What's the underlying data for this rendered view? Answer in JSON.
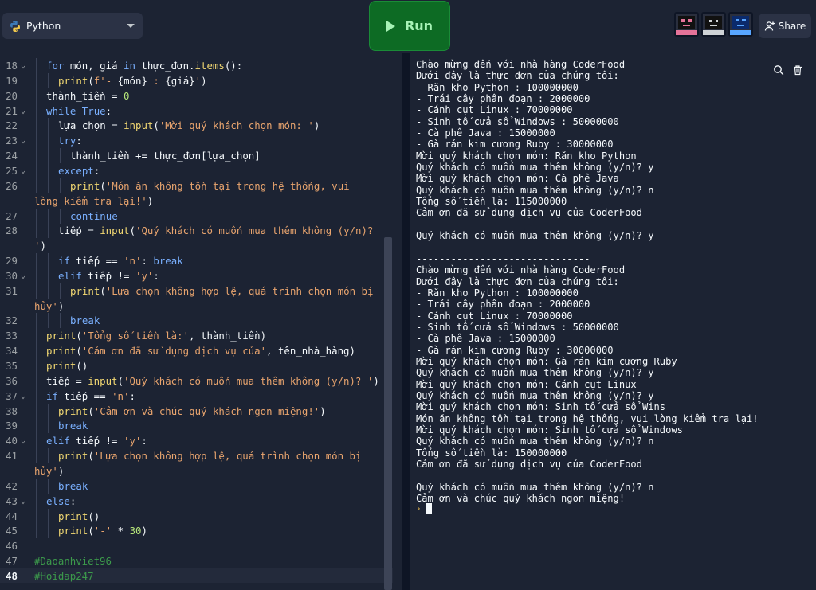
{
  "topbar": {
    "language": "Python",
    "run_label": "Run",
    "share_label": "Share"
  },
  "icons": {
    "python": "python-logo-icon",
    "dropdown": "chevron-down-icon",
    "run": "play-icon",
    "share": "add-user-icon",
    "search": "search-icon",
    "clear": "trash-icon"
  },
  "colors": {
    "accent_run": "#0d6b24",
    "run_text": "#a7f3b6",
    "keyword": "#7ab0ff",
    "function": "#f2d872",
    "string": "#e8a46e",
    "number": "#b6e67a",
    "comment": "#3c9a4b",
    "background": "#1c2333"
  },
  "editor": {
    "lines": [
      {
        "num": "18",
        "fold": true,
        "indent": 1,
        "parts": [
          [
            "k",
            "for"
          ],
          [
            "t",
            " món, giá "
          ],
          [
            "k",
            "in"
          ],
          [
            "t",
            " thực_đơn."
          ],
          [
            "f",
            "items"
          ],
          [
            "t",
            "():"
          ]
        ]
      },
      {
        "num": "19",
        "fold": false,
        "indent": 2,
        "parts": [
          [
            "f",
            "print"
          ],
          [
            "t",
            "("
          ],
          [
            "s",
            "f'- "
          ],
          [
            "t",
            "{món}"
          ],
          [
            "s",
            " : "
          ],
          [
            "t",
            "{giá}"
          ],
          [
            "s",
            "'"
          ],
          [
            "t",
            ")"
          ]
        ]
      },
      {
        "num": "20",
        "fold": false,
        "indent": 1,
        "parts": [
          [
            "t",
            "thành_tiền = "
          ],
          [
            "n",
            "0"
          ]
        ]
      },
      {
        "num": "21",
        "fold": true,
        "indent": 1,
        "parts": [
          [
            "k",
            "while"
          ],
          [
            "t",
            " "
          ],
          [
            "k",
            "True"
          ],
          [
            "t",
            ":"
          ]
        ]
      },
      {
        "num": "22",
        "fold": false,
        "indent": 2,
        "parts": [
          [
            "t",
            "lựa_chọn = "
          ],
          [
            "f",
            "input"
          ],
          [
            "t",
            "("
          ],
          [
            "s",
            "'Mời quý khách chọn món: '"
          ],
          [
            "t",
            ")"
          ]
        ]
      },
      {
        "num": "23",
        "fold": true,
        "indent": 2,
        "parts": [
          [
            "k",
            "try"
          ],
          [
            "t",
            ":"
          ]
        ]
      },
      {
        "num": "24",
        "fold": false,
        "indent": 3,
        "parts": [
          [
            "t",
            "thành_tiền += thực_đơn[lựa_chọn]"
          ]
        ]
      },
      {
        "num": "25",
        "fold": true,
        "indent": 2,
        "parts": [
          [
            "k",
            "except"
          ],
          [
            "t",
            ":"
          ]
        ]
      },
      {
        "num": "26",
        "fold": false,
        "indent": 3,
        "parts": [
          [
            "f",
            "print"
          ],
          [
            "t",
            "("
          ],
          [
            "s",
            "'Món ăn không tồn tại trong hệ thống, vui"
          ]
        ]
      },
      {
        "num": "",
        "fold": false,
        "indent": 0,
        "parts": [
          [
            "s",
            "lòng kiểm tra lại!'"
          ],
          [
            "t",
            ")"
          ]
        ]
      },
      {
        "num": "27",
        "fold": false,
        "indent": 3,
        "parts": [
          [
            "k",
            "continue"
          ]
        ]
      },
      {
        "num": "28",
        "fold": false,
        "indent": 2,
        "parts": [
          [
            "t",
            "tiếp = "
          ],
          [
            "f",
            "input"
          ],
          [
            "t",
            "("
          ],
          [
            "s",
            "'Quý khách có muốn mua thêm không (y/n)?"
          ]
        ]
      },
      {
        "num": "",
        "fold": false,
        "indent": 0,
        "parts": [
          [
            "s",
            "'"
          ],
          [
            "t",
            ")"
          ]
        ]
      },
      {
        "num": "29",
        "fold": false,
        "indent": 2,
        "parts": [
          [
            "k",
            "if"
          ],
          [
            "t",
            " tiếp == "
          ],
          [
            "s",
            "'n'"
          ],
          [
            "t",
            ": "
          ],
          [
            "k",
            "break"
          ]
        ]
      },
      {
        "num": "30",
        "fold": true,
        "indent": 2,
        "parts": [
          [
            "k",
            "elif"
          ],
          [
            "t",
            " tiếp != "
          ],
          [
            "s",
            "'y'"
          ],
          [
            "t",
            ":"
          ]
        ]
      },
      {
        "num": "31",
        "fold": false,
        "indent": 3,
        "parts": [
          [
            "f",
            "print"
          ],
          [
            "t",
            "("
          ],
          [
            "s",
            "'Lựa chọn không hợp lệ, quá trình chọn món bị"
          ]
        ]
      },
      {
        "num": "",
        "fold": false,
        "indent": 0,
        "parts": [
          [
            "s",
            "hủy'"
          ],
          [
            "t",
            ")"
          ]
        ]
      },
      {
        "num": "32",
        "fold": false,
        "indent": 3,
        "parts": [
          [
            "k",
            "break"
          ]
        ]
      },
      {
        "num": "33",
        "fold": false,
        "indent": 1,
        "parts": [
          [
            "f",
            "print"
          ],
          [
            "t",
            "("
          ],
          [
            "s",
            "'Tổng số tiền là:'"
          ],
          [
            "t",
            ", thành_tiền)"
          ]
        ]
      },
      {
        "num": "34",
        "fold": false,
        "indent": 1,
        "parts": [
          [
            "f",
            "print"
          ],
          [
            "t",
            "("
          ],
          [
            "s",
            "'Cảm ơn đã sử dụng dịch vụ của'"
          ],
          [
            "t",
            ", tên_nhà_hàng)"
          ]
        ]
      },
      {
        "num": "35",
        "fold": false,
        "indent": 1,
        "parts": [
          [
            "f",
            "print"
          ],
          [
            "t",
            "()"
          ]
        ]
      },
      {
        "num": "36",
        "fold": false,
        "indent": 1,
        "parts": [
          [
            "t",
            "tiếp = "
          ],
          [
            "f",
            "input"
          ],
          [
            "t",
            "("
          ],
          [
            "s",
            "'Quý khách có muốn mua thêm không (y/n)? '"
          ],
          [
            "t",
            ")"
          ]
        ]
      },
      {
        "num": "37",
        "fold": true,
        "indent": 1,
        "parts": [
          [
            "k",
            "if"
          ],
          [
            "t",
            " tiếp == "
          ],
          [
            "s",
            "'n'"
          ],
          [
            "t",
            ":"
          ]
        ]
      },
      {
        "num": "38",
        "fold": false,
        "indent": 2,
        "parts": [
          [
            "f",
            "print"
          ],
          [
            "t",
            "("
          ],
          [
            "s",
            "'Cảm ơn và chúc quý khách ngon miệng!'"
          ],
          [
            "t",
            ")"
          ]
        ]
      },
      {
        "num": "39",
        "fold": false,
        "indent": 2,
        "parts": [
          [
            "k",
            "break"
          ]
        ]
      },
      {
        "num": "40",
        "fold": true,
        "indent": 1,
        "parts": [
          [
            "k",
            "elif"
          ],
          [
            "t",
            " tiếp != "
          ],
          [
            "s",
            "'y'"
          ],
          [
            "t",
            ":"
          ]
        ]
      },
      {
        "num": "41",
        "fold": false,
        "indent": 2,
        "parts": [
          [
            "f",
            "print"
          ],
          [
            "t",
            "("
          ],
          [
            "s",
            "'Lựa chọn không hợp lệ, quá trình chọn món bị"
          ]
        ]
      },
      {
        "num": "",
        "fold": false,
        "indent": 0,
        "parts": [
          [
            "s",
            "hủy'"
          ],
          [
            "t",
            ")"
          ]
        ]
      },
      {
        "num": "42",
        "fold": false,
        "indent": 2,
        "parts": [
          [
            "k",
            "break"
          ]
        ]
      },
      {
        "num": "43",
        "fold": true,
        "indent": 1,
        "parts": [
          [
            "k",
            "else"
          ],
          [
            "t",
            ":"
          ]
        ]
      },
      {
        "num": "44",
        "fold": false,
        "indent": 2,
        "parts": [
          [
            "f",
            "print"
          ],
          [
            "t",
            "()"
          ]
        ]
      },
      {
        "num": "45",
        "fold": false,
        "indent": 2,
        "parts": [
          [
            "f",
            "print"
          ],
          [
            "t",
            "("
          ],
          [
            "s",
            "'-'"
          ],
          [
            "t",
            " * "
          ],
          [
            "n",
            "30"
          ],
          [
            "t",
            ")"
          ]
        ]
      },
      {
        "num": "46",
        "fold": false,
        "indent": 0,
        "parts": []
      },
      {
        "num": "47",
        "fold": false,
        "indent": 0,
        "parts": [
          [
            "c",
            "#Daoanhviet96"
          ]
        ]
      },
      {
        "num": "48",
        "fold": false,
        "indent": 0,
        "active": true,
        "parts": [
          [
            "c",
            "#Hoidap247"
          ]
        ]
      }
    ]
  },
  "console": {
    "lines": [
      "Chào mừng đến với nhà hàng CoderFood",
      "Dưới đây là thực đơn của chúng tôi:",
      "- Răn kho Python : 100000000",
      "- Trái cây phân đoạn : 2000000",
      "- Cánh cụt Linux : 70000000",
      "- Sinh tố cửa sổ Windows : 50000000",
      "- Cà phê Java : 15000000",
      "- Gà rán kim cương Ruby : 30000000",
      "Mời quý khách chọn món: Răn kho Python",
      "Quý khách có muốn mua thêm không (y/n)? y",
      "Mời quý khách chọn món: Cà phê Java",
      "Quý khách có muốn mua thêm không (y/n)? n",
      "Tổng số tiền là: 115000000",
      "Cảm ơn đã sử dụng dịch vụ của CoderFood",
      "",
      "Quý khách có muốn mua thêm không (y/n)? y",
      "",
      "------------------------------",
      "Chào mừng đến với nhà hàng CoderFood",
      "Dưới đây là thực đơn của chúng tôi:",
      "- Răn kho Python : 100000000",
      "- Trái cây phân đoạn : 2000000",
      "- Cánh cụt Linux : 70000000",
      "- Sinh tố cửa sổ Windows : 50000000",
      "- Cà phê Java : 15000000",
      "- Gà rán kim cương Ruby : 30000000",
      "Mời quý khách chọn món: Gà rán kim cương Ruby",
      "Quý khách có muốn mua thêm không (y/n)? y",
      "Mời quý khách chọn món: Cánh cụt Linux",
      "Quý khách có muốn mua thêm không (y/n)? y",
      "Mời quý khách chọn món: Sinh tố cửa sổ Wins",
      "Món ăn không tồn tại trong hệ thống, vui lòng kiểm tra lại!",
      "Mời quý khách chọn món: Sinh tố cửa sổ Windows",
      "Quý khách có muốn mua thêm không (y/n)? n",
      "Tổng số tiền là: 150000000",
      "Cảm ơn đã sử dụng dịch vụ của CoderFood",
      "",
      "Quý khách có muốn mua thêm không (y/n)? n",
      "Cảm ơn và chúc quý khách ngon miệng!"
    ],
    "prompt": "›"
  }
}
